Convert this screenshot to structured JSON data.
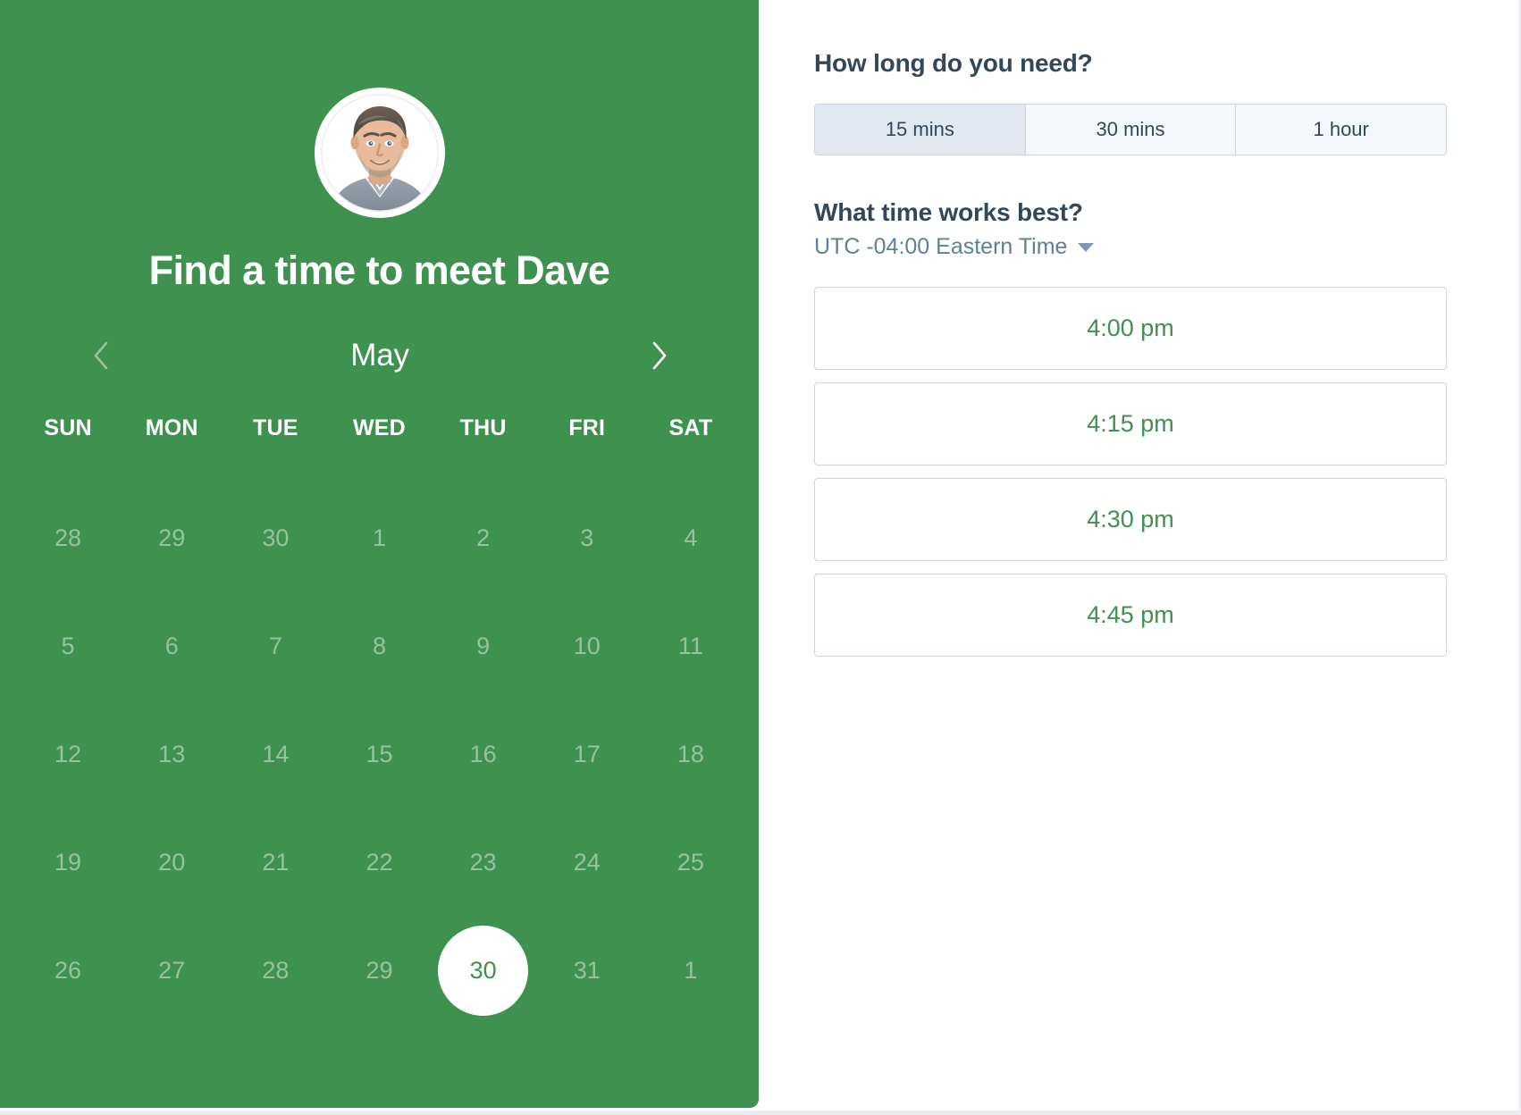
{
  "left_panel": {
    "background_color": "#3f9150",
    "avatar": {
      "alt": "Dave profile photo",
      "icon": "avatar-photo"
    },
    "title": "Find a time to meet Dave",
    "calendar": {
      "month_label": "May",
      "prev_icon": "chevron-left-icon",
      "next_icon": "chevron-right-icon",
      "weekday_headers": [
        "SUN",
        "MON",
        "TUE",
        "WED",
        "THU",
        "FRI",
        "SAT"
      ],
      "selected_day": "30",
      "selected_day_text_color": "#3f9150",
      "weeks": [
        [
          {
            "label": "28",
            "state": "muted"
          },
          {
            "label": "29",
            "state": "muted"
          },
          {
            "label": "30",
            "state": "muted"
          },
          {
            "label": "1",
            "state": "muted"
          },
          {
            "label": "2",
            "state": "muted"
          },
          {
            "label": "3",
            "state": "muted"
          },
          {
            "label": "4",
            "state": "muted"
          }
        ],
        [
          {
            "label": "5",
            "state": "muted"
          },
          {
            "label": "6",
            "state": "muted"
          },
          {
            "label": "7",
            "state": "muted"
          },
          {
            "label": "8",
            "state": "muted"
          },
          {
            "label": "9",
            "state": "muted"
          },
          {
            "label": "10",
            "state": "muted"
          },
          {
            "label": "11",
            "state": "muted"
          }
        ],
        [
          {
            "label": "12",
            "state": "muted"
          },
          {
            "label": "13",
            "state": "muted"
          },
          {
            "label": "14",
            "state": "muted"
          },
          {
            "label": "15",
            "state": "muted"
          },
          {
            "label": "16",
            "state": "muted"
          },
          {
            "label": "17",
            "state": "muted"
          },
          {
            "label": "18",
            "state": "muted"
          }
        ],
        [
          {
            "label": "19",
            "state": "muted"
          },
          {
            "label": "20",
            "state": "muted"
          },
          {
            "label": "21",
            "state": "muted"
          },
          {
            "label": "22",
            "state": "muted"
          },
          {
            "label": "23",
            "state": "muted"
          },
          {
            "label": "24",
            "state": "muted"
          },
          {
            "label": "25",
            "state": "muted"
          }
        ],
        [
          {
            "label": "26",
            "state": "muted"
          },
          {
            "label": "27",
            "state": "muted"
          },
          {
            "label": "28",
            "state": "muted"
          },
          {
            "label": "29",
            "state": "muted"
          },
          {
            "label": "30",
            "state": "selected"
          },
          {
            "label": "31",
            "state": "muted"
          },
          {
            "label": "1",
            "state": "muted"
          }
        ]
      ]
    }
  },
  "right_panel": {
    "duration": {
      "heading": "How long do you need?",
      "options": [
        {
          "label": "15 mins",
          "selected": true
        },
        {
          "label": "30 mins",
          "selected": false
        },
        {
          "label": "1 hour",
          "selected": false
        }
      ]
    },
    "time": {
      "heading": "What time works best?",
      "timezone_label": "UTC -04:00 Eastern Time",
      "timezone_caret_icon": "caret-down-icon",
      "slots": [
        {
          "label": "4:00 pm"
        },
        {
          "label": "4:15 pm"
        },
        {
          "label": "4:30 pm"
        },
        {
          "label": "4:45 pm"
        }
      ],
      "slot_text_color": "#3f9150"
    }
  }
}
